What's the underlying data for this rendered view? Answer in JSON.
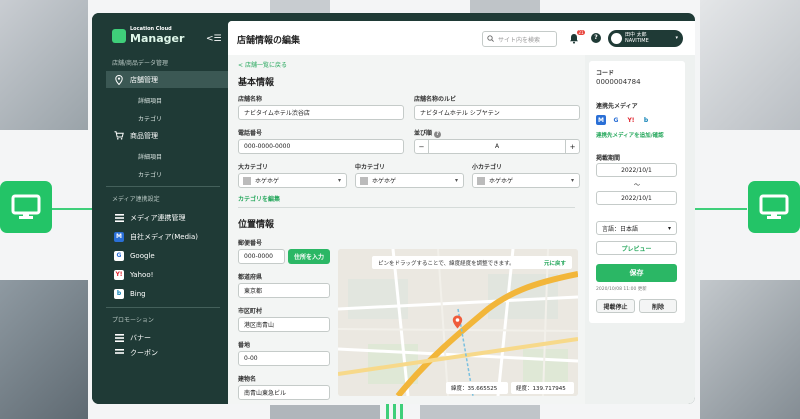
{
  "sidebar": {
    "logo_small": "Location Cloud",
    "logo_big": "Manager",
    "section_store": "店舗/商品データ管理",
    "store_mgmt": "店舗管理",
    "store_detail": "詳細項目",
    "store_category": "カテゴリ",
    "product_mgmt": "商品管理",
    "product_detail": "詳細項目",
    "product_category": "カテゴリ",
    "section_media": "メディア連携設定",
    "media_mgmt": "メディア連携管理",
    "own_media": "自社メディア(Media)",
    "google": "Google",
    "yahoo": "Yahoo!",
    "bing": "Bing",
    "section_promo": "プロモーション",
    "banner": "バナー",
    "cut_item": "クーポン"
  },
  "header": {
    "title": "店舗情報の編集",
    "search_placeholder": "サイト内を検索",
    "notification_count": "21",
    "user_name": "田中 太郎",
    "user_org": "NAVITIME"
  },
  "form": {
    "back_link": "店舗一覧に戻る",
    "basic_title": "基本情報",
    "store_name_label": "店舗名称",
    "store_name_value": "ナビタイムホテル渋谷店",
    "store_ruby_label": "店舗名称のルビ",
    "store_ruby_value": "ナビタイムホテル シブヤテン",
    "phone_label": "電話番号",
    "phone_value": "000-0000-0000",
    "order_label": "並び順",
    "order_value": "A",
    "cat_large_label": "大カテゴリ",
    "cat_mid_label": "中カテゴリ",
    "cat_small_label": "小カテゴリ",
    "cat_placeholder": "ホゲホゲ",
    "category_edit": "カテゴリを編集",
    "location_title": "位置情報",
    "postal_label": "郵便番号",
    "postal_value": "000-0000",
    "address_input_btn": "住所を入力",
    "pref_label": "都道府県",
    "pref_value": "東京都",
    "city_label": "市区町村",
    "city_value": "港区南青山",
    "block_label": "番地",
    "block_value": "0-00",
    "building_label": "建物名",
    "building_value": "南青山東急ビル"
  },
  "map": {
    "hint": "ピンをドラッグすることで、緯度経度を調整できます。",
    "reset": "元に戻す",
    "lat": "緯度：35.665525",
    "lng": "経度：139.717945"
  },
  "panel": {
    "code_label": "コード",
    "code_value": "0000004784",
    "media_label": "連携先メディア",
    "media_add": "連携先メディアを追加/確認",
    "period_label": "掲載期間",
    "period_start": "2022/10/1",
    "period_sep": "〜",
    "period_end": "2022/10/1",
    "language": "言語：日本語",
    "preview": "プレビュー",
    "save": "保存",
    "updated": "2020/10/08 11:00 更新",
    "stop": "掲載停止",
    "delete": "削除"
  },
  "colors": {
    "brand_dark": "#1f3a36",
    "accent_green": "#2bb765"
  }
}
